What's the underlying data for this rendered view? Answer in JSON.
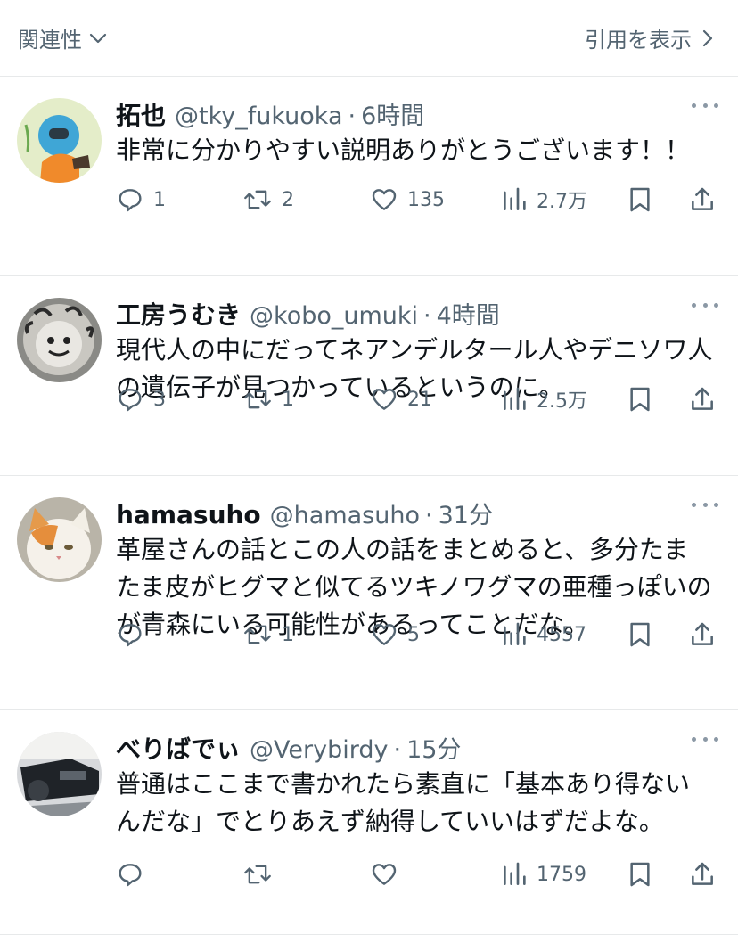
{
  "topbar": {
    "sort_label": "関連性",
    "quotes_label": "引用を表示"
  },
  "replies": [
    {
      "name": "拓也",
      "handle": "@tky_fukuoka",
      "separator": "·",
      "time": "6時間",
      "text": "非常に分かりやすい説明ありがとうございます！！",
      "replies_count": "1",
      "retweets_count": "2",
      "likes_count": "135",
      "views_count": "2.7万"
    },
    {
      "name": "工房うむき",
      "handle": "@kobo_umuki",
      "separator": "·",
      "time": "4時間",
      "text": "現代人の中にだってネアンデルタール人やデニソワ人の遺伝子が見つかっているというのに。",
      "replies_count": "3",
      "retweets_count": "1",
      "likes_count": "21",
      "views_count": "2.5万"
    },
    {
      "name": "hamasuho",
      "handle": "@hamasuho",
      "separator": "·",
      "time": "31分",
      "text": "革屋さんの話とこの人の話をまとめると、多分たまたま皮がヒグマと似てるツキノワグマの亜種っぽいのが青森にいる可能性があるってことだな。",
      "replies_count": "",
      "retweets_count": "1",
      "likes_count": "5",
      "views_count": "4557"
    },
    {
      "name": "べりばでぃ",
      "handle": "@Verybirdy",
      "separator": "·",
      "time": "15分",
      "text": "普通はここまで書かれたら素直に「基本あり得ないんだな」でとりあえず納得していいはずだよな。",
      "replies_count": "",
      "retweets_count": "",
      "likes_count": "",
      "views_count": "1759"
    }
  ],
  "icons": {
    "sort": "chevron-down-icon",
    "quotes": "chevron-right-icon",
    "reply": "speech-bubble-icon",
    "retweet": "retweet-icon",
    "like": "heart-icon",
    "views": "bar-chart-icon",
    "bookmark": "bookmark-icon",
    "share": "share-upload-icon",
    "more": "more-dots-icon"
  },
  "colors": {
    "text": "#0f1419",
    "secondary": "#536471",
    "divider": "#e7e9ea",
    "background": "#ffffff"
  }
}
